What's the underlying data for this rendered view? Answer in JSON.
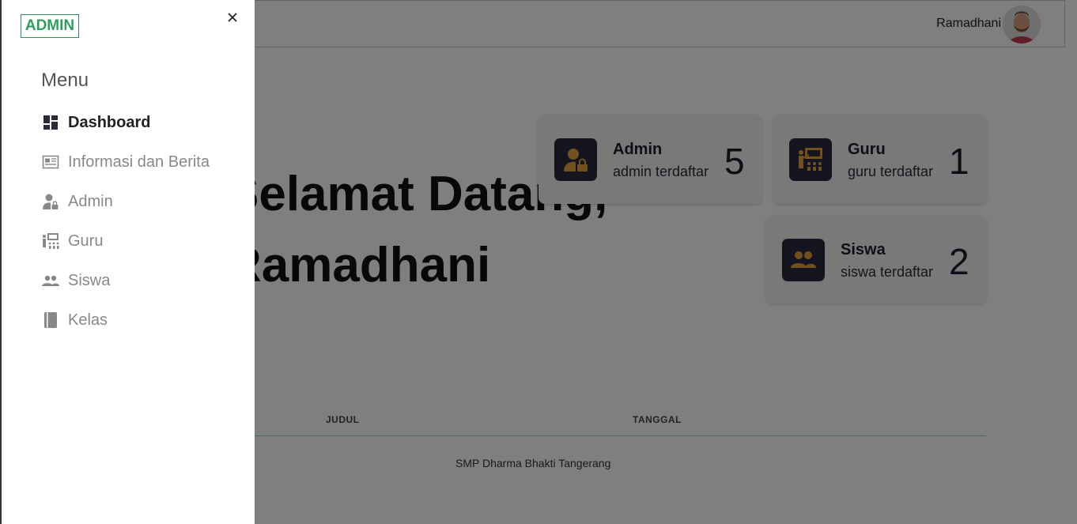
{
  "header": {
    "username": "Ramadhani"
  },
  "welcome": {
    "line1": "Selamat Datang,",
    "line2": "Ramadhani"
  },
  "stats": [
    {
      "title": "Admin",
      "subtitle": "admin terdaftar",
      "count": "5",
      "icon": "admin-icon"
    },
    {
      "title": "Guru",
      "subtitle": "guru terdaftar",
      "count": "1",
      "icon": "teacher-icon"
    },
    {
      "title": "Siswa",
      "subtitle": "siswa terdaftar",
      "count": "2",
      "icon": "students-icon"
    }
  ],
  "table": {
    "columns": [
      "JUDUL",
      "TANGGAL"
    ]
  },
  "footer": {
    "text": "SMP Dharma Bhakti Tangerang"
  },
  "sidebar": {
    "logo": "ADMIN",
    "menu_title": "Menu",
    "items": [
      {
        "label": "Dashboard",
        "icon": "dashboard-icon",
        "active": true
      },
      {
        "label": "Informasi dan Berita",
        "icon": "news-icon",
        "active": false
      },
      {
        "label": "Admin",
        "icon": "admin-icon",
        "active": false
      },
      {
        "label": "Guru",
        "icon": "teacher-icon",
        "active": false
      },
      {
        "label": "Siswa",
        "icon": "students-icon",
        "active": false
      },
      {
        "label": "Kelas",
        "icon": "book-icon",
        "active": false
      }
    ]
  },
  "colors": {
    "accent": "#e6a23c",
    "icon_bg": "#2a2a40",
    "logo_green": "#2e9e5a",
    "overlay": "rgba(0,0,0,0.5)"
  }
}
